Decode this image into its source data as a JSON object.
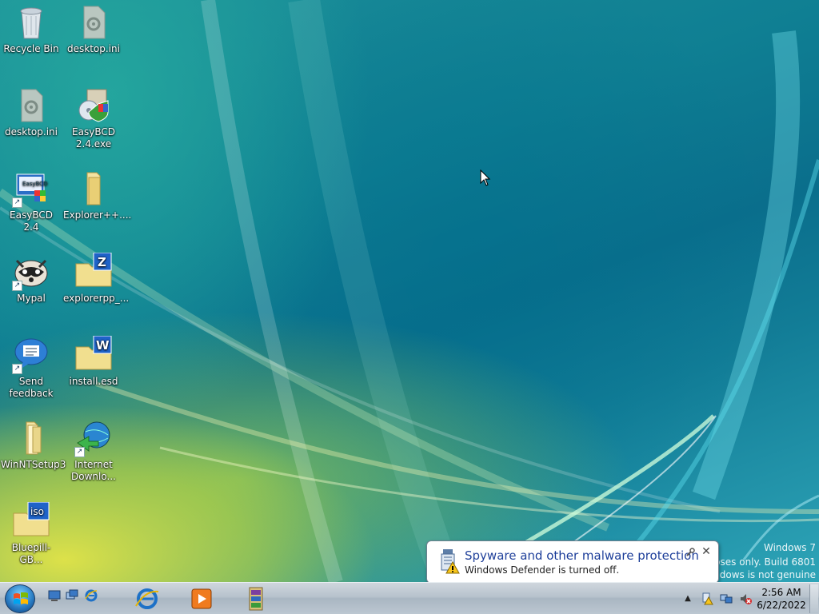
{
  "desktop_icons": [
    {
      "label": "Recycle Bin",
      "icon": "recycle-bin-icon"
    },
    {
      "label": "desktop.ini",
      "icon": "config-file-icon"
    },
    {
      "label": "desktop.ini",
      "icon": "config-file-icon"
    },
    {
      "label": "EasyBCD\n2.4.exe",
      "icon": "installer-icon"
    },
    {
      "label": "EasyBCD 2.4",
      "icon": "easybcd-icon"
    },
    {
      "label": "Explorer++....",
      "icon": "folder-icon"
    },
    {
      "label": "Mypal",
      "icon": "mypal-raccoon-icon"
    },
    {
      "label": "explorerpp_...",
      "icon": "zip-archive-icon"
    },
    {
      "label": "Send\nfeedback",
      "icon": "feedback-bubble-icon"
    },
    {
      "label": "install.esd",
      "icon": "esd-file-icon"
    },
    {
      "label": "WinNTSetup3",
      "icon": "folder-icon"
    },
    {
      "label": "Internet\nDownlo...",
      "icon": "internet-download-manager-icon"
    },
    {
      "label": "Bluepill-GB...",
      "icon": "iso-file-icon"
    }
  ],
  "watermark": {
    "line1": "Windows 7",
    "line2": "poses only. Build 6801",
    "line3": "ndows is not genuine"
  },
  "notification": {
    "title": "Spyware and other malware protection",
    "message": "Windows Defender is turned off.",
    "close_glyph": "✕"
  },
  "taskbar": {
    "quick_launch": [
      "show-desktop-icon",
      "switch-windows-icon",
      "internet-explorer-icon"
    ],
    "pinned": [
      "internet-explorer-icon",
      "media-player-icon",
      "winrar-icon"
    ],
    "tray_arrow": "▲",
    "clock": {
      "time": "2:56 AM",
      "date": "6/22/2022"
    }
  },
  "colors": {
    "taskbar_top": "#cfd6dd",
    "balloon_title": "#1e3f9a",
    "desktop_teal": "#0f7f93",
    "desktop_yellow": "#e6e646"
  }
}
